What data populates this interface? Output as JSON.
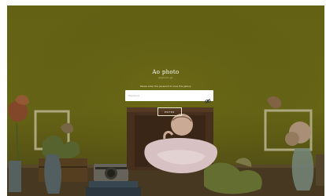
{
  "site": {
    "title": "Ao photo",
    "subtitle": "aophoto.jp"
  },
  "login": {
    "instruction": "Please enter the password to view this gallery.",
    "password_placeholder": "Password",
    "enter_label": "ENTER",
    "visibility_icon": "eye-toggle-icon"
  },
  "colors": {
    "backdrop": "#6c6a14",
    "input_bg": "#ffffff",
    "text": "#ffffff"
  }
}
